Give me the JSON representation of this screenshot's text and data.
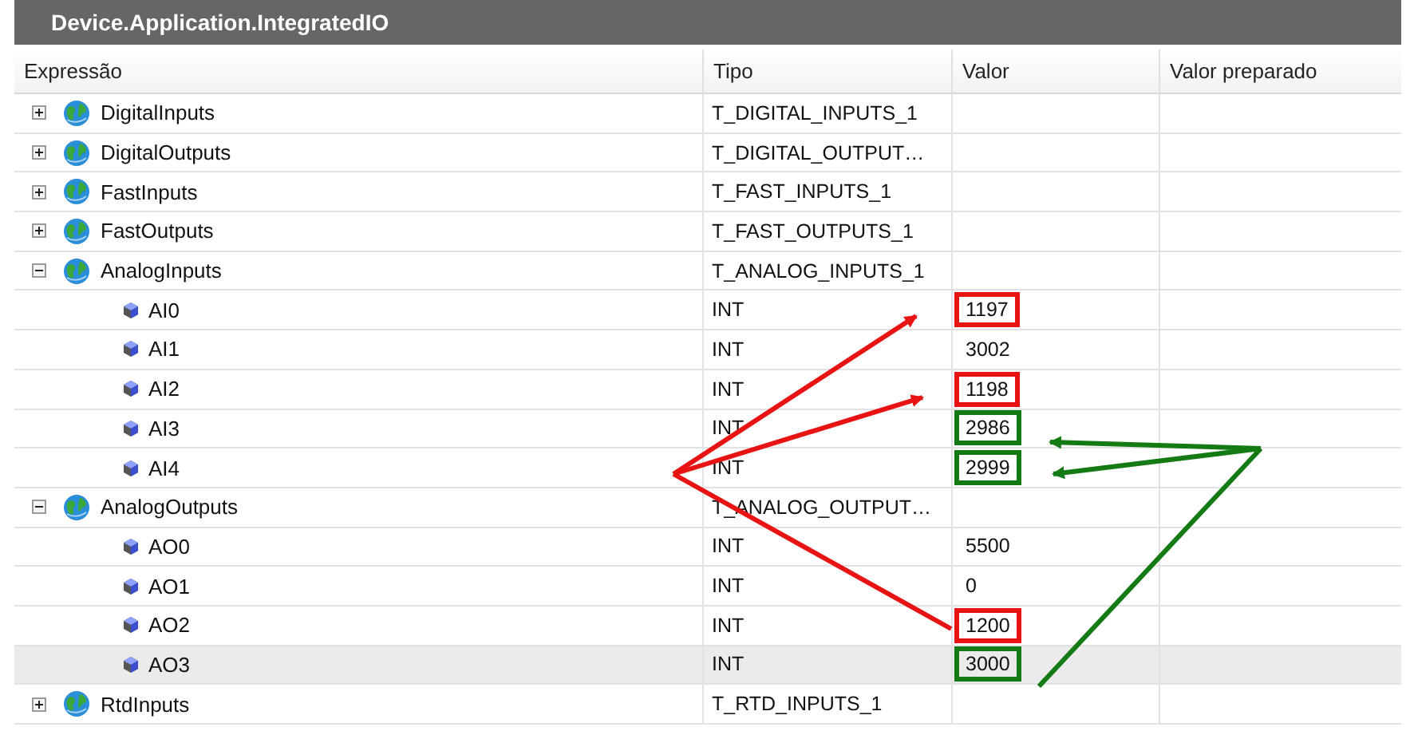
{
  "panel": {
    "title": "Device.Application.IntegratedIO"
  },
  "columns": [
    "Expressão",
    "Tipo",
    "Valor",
    "Valor preparado"
  ],
  "rows": [
    {
      "kind": "group",
      "name": "DigitalInputs",
      "type": "T_DIGITAL_INPUTS_1",
      "expanded": false,
      "selected": false
    },
    {
      "kind": "group",
      "name": "DigitalOutputs",
      "type": "T_DIGITAL_OUTPUT…",
      "expanded": false,
      "selected": false
    },
    {
      "kind": "group",
      "name": "FastInputs",
      "type": "T_FAST_INPUTS_1",
      "expanded": false,
      "selected": false
    },
    {
      "kind": "group",
      "name": "FastOutputs",
      "type": "T_FAST_OUTPUTS_1",
      "expanded": false,
      "selected": false
    },
    {
      "kind": "group",
      "name": "AnalogInputs",
      "type": "T_ANALOG_INPUTS_1",
      "expanded": true,
      "selected": false,
      "children": [
        {
          "kind": "variable",
          "name": "AI0",
          "type": "INT",
          "value": "1197",
          "color": "#e81414",
          "selected": false
        },
        {
          "kind": "variable",
          "name": "AI1",
          "type": "INT",
          "value": "3002",
          "selected": false
        },
        {
          "kind": "variable",
          "name": "AI2",
          "type": "INT",
          "value": "1198",
          "color": "#e81414",
          "selected": false
        },
        {
          "kind": "variable",
          "name": "AI3",
          "type": "INT",
          "value": "2986",
          "color": "#147a14",
          "selected": false
        },
        {
          "kind": "variable",
          "name": "AI4",
          "type": "INT",
          "value": "2999",
          "color": "#147a14",
          "selected": false
        }
      ]
    },
    {
      "kind": "group",
      "name": "AnalogOutputs",
      "type": "T_ANALOG_OUTPUT…",
      "expanded": true,
      "selected": false,
      "children": [
        {
          "kind": "variable",
          "name": "AO0",
          "type": "INT",
          "value": "5500",
          "selected": false
        },
        {
          "kind": "variable",
          "name": "AO1",
          "type": "INT",
          "value": "0",
          "selected": false
        },
        {
          "kind": "variable",
          "name": "AO2",
          "type": "INT",
          "value": "1200",
          "color": "#e81414",
          "selected": false
        },
        {
          "kind": "variable",
          "name": "AO3",
          "type": "INT",
          "value": "3000",
          "color": "#147a14",
          "selected": true
        }
      ]
    },
    {
      "kind": "group",
      "name": "RtdInputs",
      "type": "T_RTD_INPUTS_1",
      "expanded": false,
      "selected": false
    }
  ]
}
